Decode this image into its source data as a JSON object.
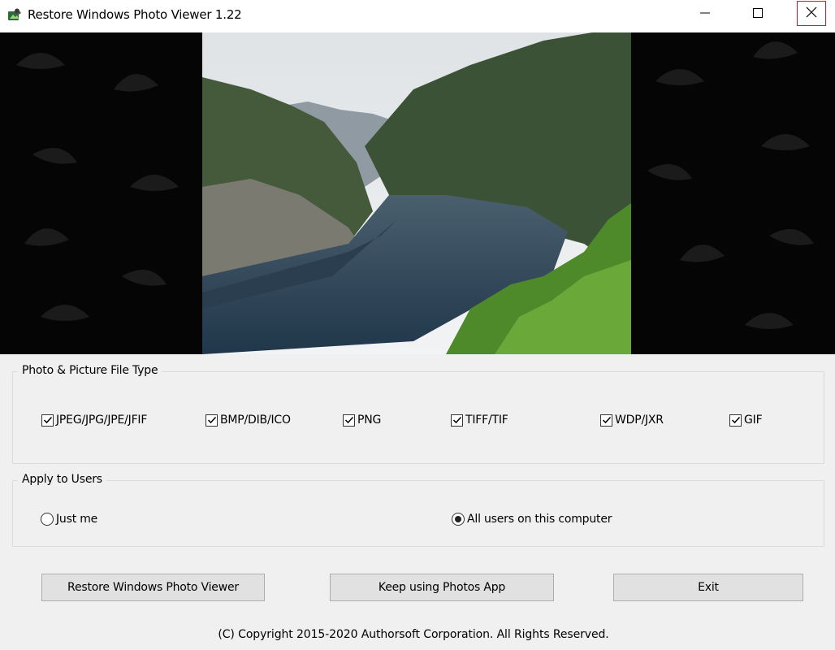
{
  "window": {
    "title": "Restore Windows Photo Viewer 1.22",
    "icons": [
      "app-icon",
      "minimize-icon",
      "maximize-icon",
      "close-icon"
    ]
  },
  "file_types": {
    "legend": "Photo & Picture File Type",
    "items": [
      {
        "label": "JPEG/JPG/JPE/JFIF",
        "checked": true
      },
      {
        "label": "BMP/DIB/ICO",
        "checked": true
      },
      {
        "label": "PNG",
        "checked": true
      },
      {
        "label": "TIFF/TIF",
        "checked": true
      },
      {
        "label": "WDP/JXR",
        "checked": true
      },
      {
        "label": "GIF",
        "checked": true
      }
    ]
  },
  "users": {
    "legend": "Apply to Users",
    "options": [
      {
        "label": "Just me",
        "selected": false
      },
      {
        "label": "All users on this computer",
        "selected": true
      }
    ]
  },
  "buttons": {
    "restore": "Restore Windows Photo Viewer",
    "keep": "Keep using Photos App",
    "exit": "Exit"
  },
  "footer": {
    "copyright": "(C) Copyright 2015-2020 Authorsoft Corporation. All Rights Reserved."
  },
  "colors": {
    "close_outline": "#e81123",
    "window_bg": "#f0f0f0",
    "viewer_bg": "#050505"
  }
}
